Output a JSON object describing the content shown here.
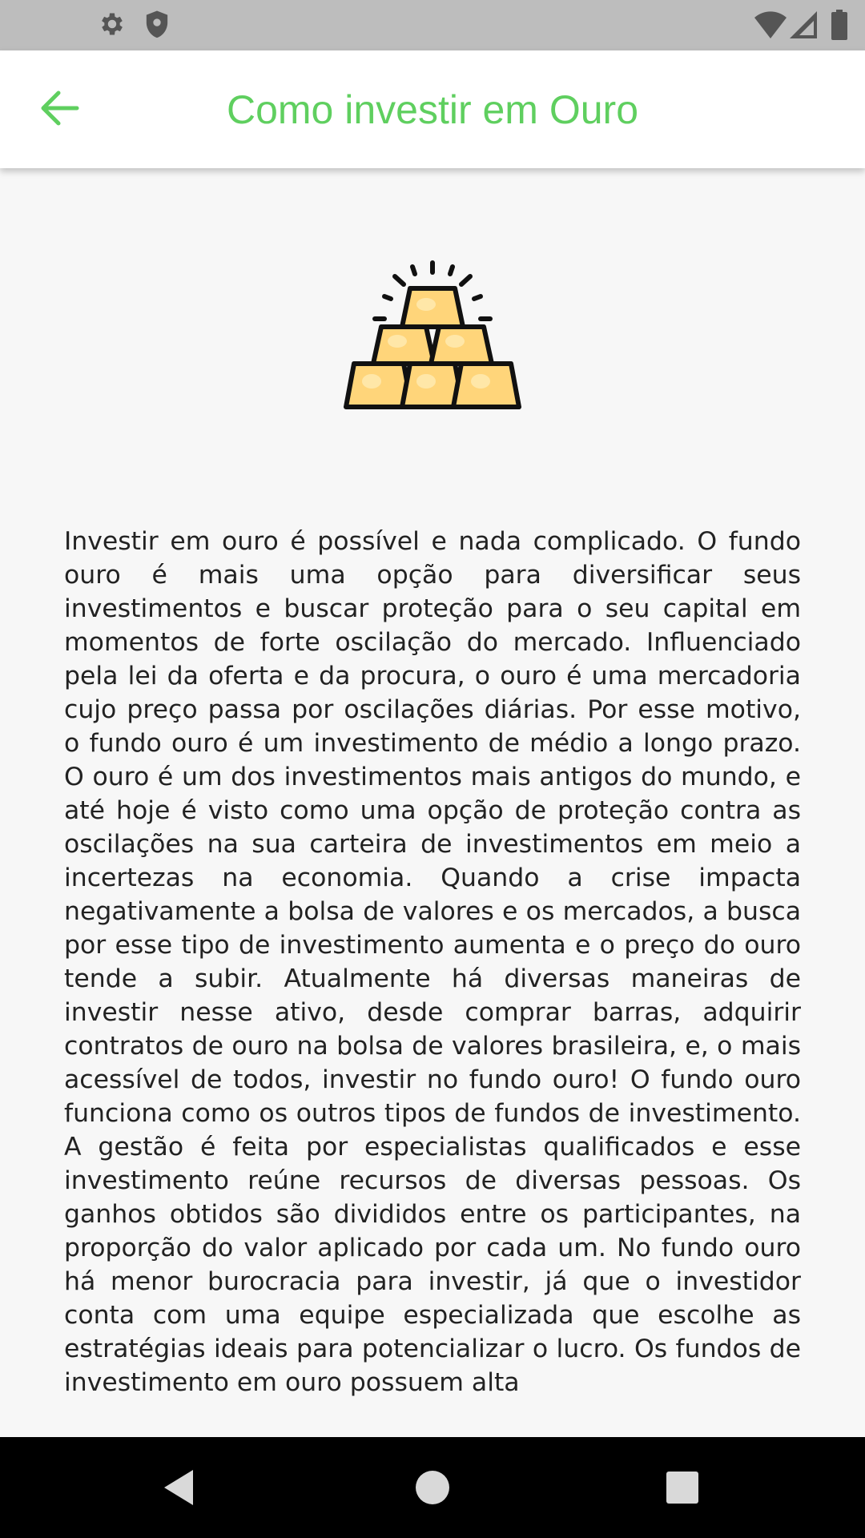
{
  "status_bar": {
    "icons": [
      "gear-icon",
      "shield-icon",
      "wifi-icon",
      "signal-icon",
      "battery-icon"
    ]
  },
  "app_bar": {
    "back_icon": "arrow-left-icon",
    "title": "Como investir em Ouro",
    "accent_color": "#5fcf5f"
  },
  "content": {
    "illustration": "gold-bars-icon",
    "body": "Investir em ouro é possível e nada complicado. O fundo ouro é mais uma opção para diversificar seus investimentos e buscar proteção para o seu capital em momentos de forte oscilação do mercado. Influenciado pela lei da oferta e da procura, o ouro é uma mercadoria cujo preço passa por oscilações diárias. Por esse motivo, o fundo ouro é um investimento de médio a longo prazo. O ouro é um dos investimentos mais antigos do mundo, e até hoje é visto como uma opção de proteção contra as oscilações na sua carteira de investimentos em meio a incertezas na economia. Quando a crise impacta negativamente a bolsa de valores e os mercados, a busca por esse tipo de investimento aumenta e o preço do ouro tende a subir. Atualmente há diversas maneiras de investir nesse ativo, desde comprar barras, adquirir contratos de ouro na bolsa de valores brasileira, e, o mais acessível de todos, investir no fundo ouro! O fundo ouro funciona como os outros tipos de fundos de investimento. A gestão é feita por especialistas qualificados e esse investimento reúne recursos de diversas pessoas. Os ganhos obtidos são divididos entre os participantes, na proporção do valor aplicado por cada um. No fundo ouro há menor burocracia para investir, já que o investidor conta com uma equipe especializada que escolhe as estratégias ideais para potencializar o lucro. Os fundos de investimento em ouro possuem alta"
  },
  "nav_bar": {
    "icons": [
      "back-triangle-icon",
      "home-circle-icon",
      "recents-square-icon"
    ]
  }
}
